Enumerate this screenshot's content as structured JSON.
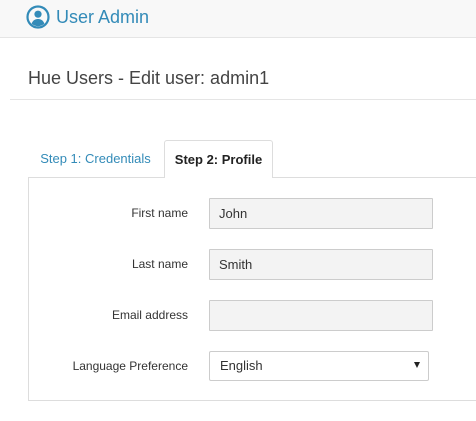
{
  "header": {
    "app_title": "User Admin",
    "logo_icon": "user-circle-icon",
    "accent_color": "#338bb8"
  },
  "page": {
    "title": "Hue Users - Edit user: admin1"
  },
  "tabs": [
    {
      "label": "Step 1: Credentials",
      "active": false
    },
    {
      "label": "Step 2: Profile",
      "active": true
    }
  ],
  "form": {
    "first_name": {
      "label": "First name",
      "value": "John"
    },
    "last_name": {
      "label": "Last name",
      "value": "Smith"
    },
    "email": {
      "label": "Email address",
      "value": ""
    },
    "language": {
      "label": "Language Preference",
      "selected": "English",
      "icon": "chevron-down-icon"
    }
  }
}
